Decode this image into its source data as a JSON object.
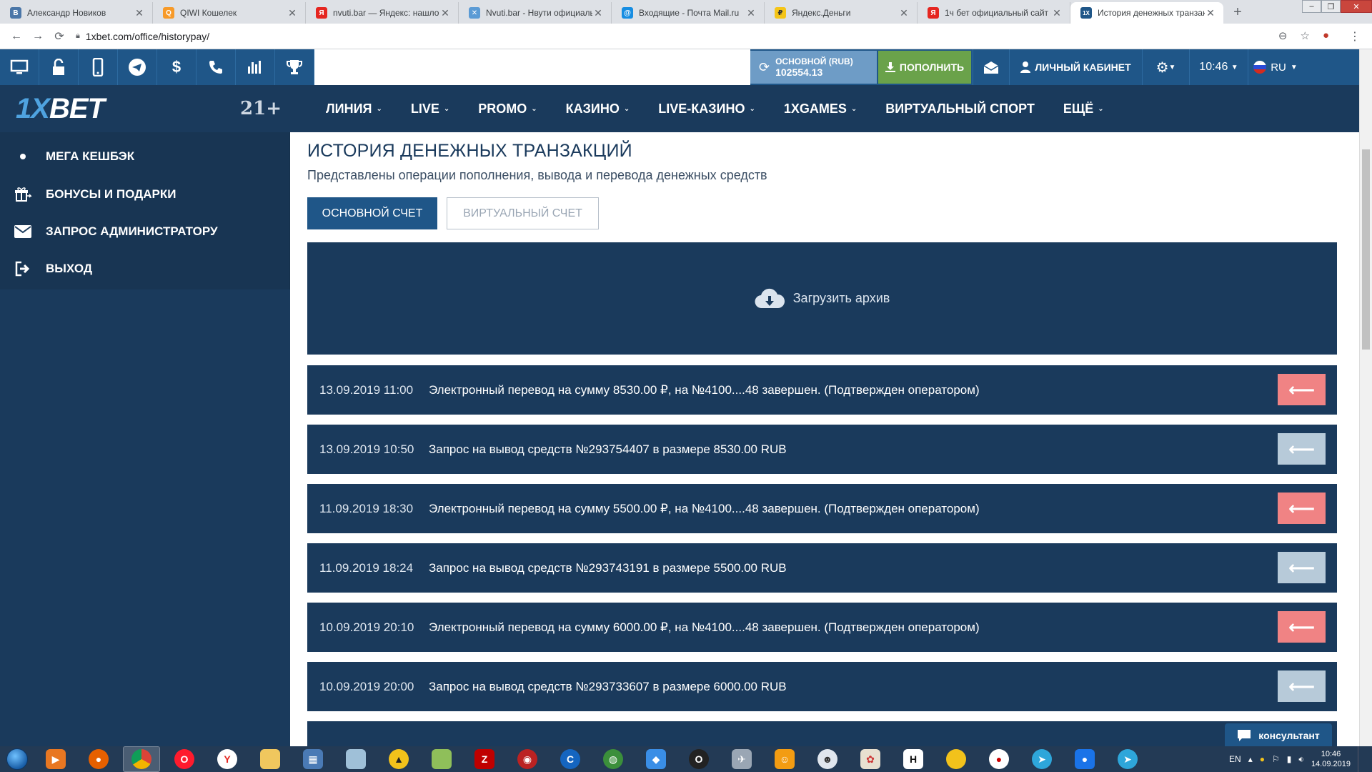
{
  "browser": {
    "tabs": [
      {
        "title": "Александр Новиков",
        "fav": "vk-icon",
        "color": "#4a76a8",
        "glyph": "B"
      },
      {
        "title": "QIWI Кошелек",
        "fav": "qiwi-icon",
        "color": "#f79a29",
        "glyph": "Q"
      },
      {
        "title": "nvuti.bar — Яндекс: нашлось",
        "fav": "yandex-icon",
        "color": "#e52620",
        "glyph": "Я"
      },
      {
        "title": "Nvuti.bar - Нвути официальный",
        "fav": "nvuti-icon",
        "color": "#5b9bd5",
        "glyph": "✕"
      },
      {
        "title": "Входящие - Почта Mail.ru",
        "fav": "mail-icon",
        "color": "#168de2",
        "glyph": "@"
      },
      {
        "title": "Яндекс.Деньги",
        "fav": "yandex-money-icon",
        "color": "#f5c518",
        "glyph": "₽"
      },
      {
        "title": "1ч бет официальный сайт -",
        "fav": "yandex-icon",
        "color": "#e52620",
        "glyph": "Я"
      },
      {
        "title": "История денежных транзакций",
        "fav": "1xbet-icon",
        "color": "#1f5688",
        "glyph": "1X"
      }
    ],
    "url": "1xbet.com/office/historypay/"
  },
  "topbar": {
    "balance_label": "ОСНОВНОЙ (RUB)",
    "balance_value": "102554.13",
    "deposit_label": "ПОПОЛНИТЬ",
    "cabinet_label": "ЛИЧНЫЙ КАБИНЕТ",
    "time": "10:46",
    "lang": "RU"
  },
  "nav": {
    "logo_prefix": "1X",
    "logo_suffix": "BET",
    "age": "21+",
    "items": [
      "ЛИНИЯ",
      "LIVE",
      "PROMO",
      "КАЗИНО",
      "LIVE-КАЗИНО",
      "1XGAMES",
      "ВИРТУАЛЬНЫЙ СПОРТ",
      "ЕЩЁ"
    ]
  },
  "sidebar": {
    "items": [
      {
        "label": "МЕГА КЕШБЭК",
        "icon": "dot-icon"
      },
      {
        "label": "БОНУСЫ И ПОДАРКИ",
        "icon": "gift-icon"
      },
      {
        "label": "ЗАПРОС АДМИНИСТРАТОРУ",
        "icon": "envelope-icon"
      },
      {
        "label": "ВЫХОД",
        "icon": "logout-icon"
      }
    ]
  },
  "content": {
    "title": "ИСТОРИЯ ДЕНЕЖНЫХ ТРАНЗАКЦИЙ",
    "subtitle": "Представлены операции пополнения, вывода и перевода денежных средств",
    "btn_main": "ОСНОВНОЙ СЧЕТ",
    "btn_virtual": "ВИРТУАЛЬНЫЙ СЧЕТ",
    "archive": "Загрузить архив",
    "transactions": [
      {
        "date": "13.09.2019 11:00",
        "text": "Электронный перевод на сумму 8530.00 ₽, на №4100....48 завершен. (Подтвержден оператором)",
        "kind": "red"
      },
      {
        "date": "13.09.2019 10:50",
        "text": "Запрос на вывод средств №293754407 в размере 8530.00 RUB",
        "kind": "gray"
      },
      {
        "date": "11.09.2019 18:30",
        "text": "Электронный перевод на сумму 5500.00 ₽, на №4100....48 завершен. (Подтвержден оператором)",
        "kind": "red"
      },
      {
        "date": "11.09.2019 18:24",
        "text": "Запрос на вывод средств №293743191 в размере 5500.00 RUB",
        "kind": "gray"
      },
      {
        "date": "10.09.2019 20:10",
        "text": "Электронный перевод на сумму 6000.00 ₽, на №4100....48 завершен. (Подтвержден оператором)",
        "kind": "red"
      },
      {
        "date": "10.09.2019 20:00",
        "text": "Запрос на вывод средств №293733607 в размере 6000.00 RUB",
        "kind": "gray"
      }
    ],
    "consultant": "консультант"
  },
  "taskbar": {
    "lang": "EN",
    "time": "10:46",
    "date": "14.09.2019"
  }
}
